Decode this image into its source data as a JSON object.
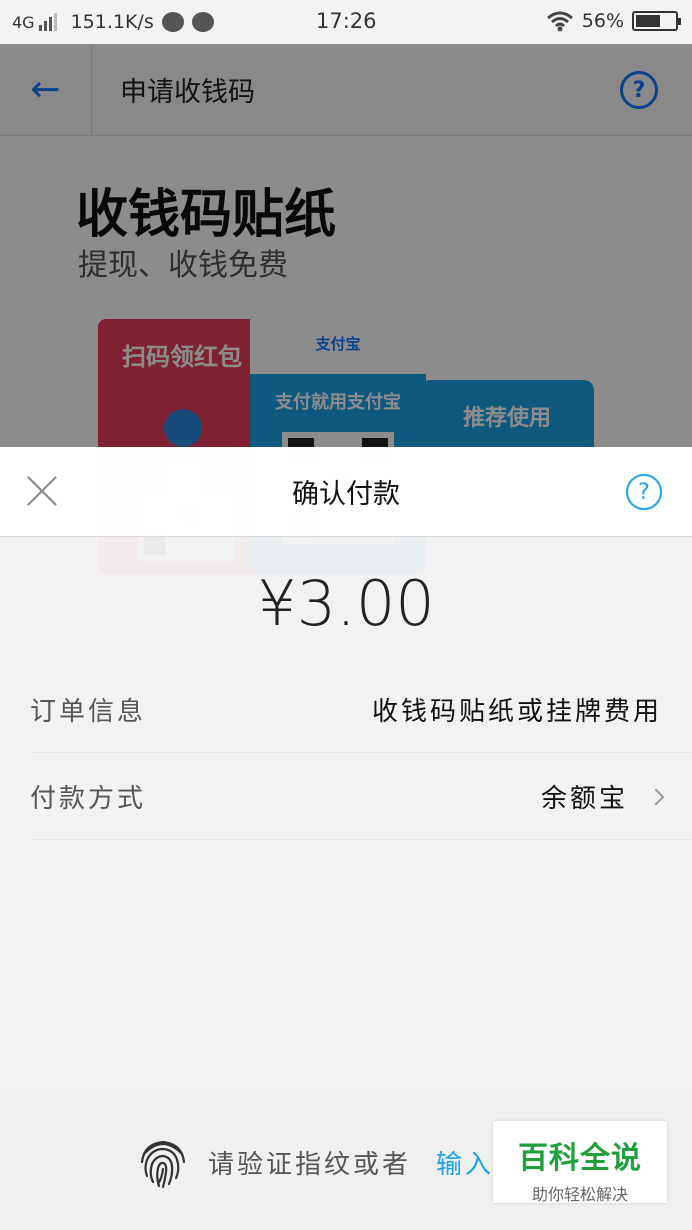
{
  "status_bar": {
    "network": "4G",
    "speed": "151.1K/s",
    "time": "17:26",
    "battery": "56%",
    "battery_level": 0.56
  },
  "background_page": {
    "title": "申请收钱码",
    "help_glyph": "?",
    "promo_title": "收钱码贴纸",
    "promo_subtitle": "提现、收钱免费",
    "sticker_red_text": "扫码领红包",
    "sticker_blue_logo": "支付宝",
    "sticker_blue_text": "支付就用支付宝",
    "recommend_label": "推荐使用"
  },
  "dialog": {
    "title": "确认付款",
    "help_glyph": "?",
    "amount": "¥3.00",
    "rows": [
      {
        "label": "订单信息",
        "value": "收钱码贴纸或挂牌费用"
      },
      {
        "label": "付款方式",
        "value": "余额宝"
      }
    ],
    "fingerprint_prompt": "请验证指纹或者",
    "input_link": "输入"
  },
  "watermark": {
    "main": "百科全说",
    "sub": "助你轻松解决"
  },
  "colors": {
    "accent": "#1da1e6",
    "alipay_blue": "#1677ff",
    "red_sticker": "#e83c5b",
    "watermark_green": "#1fa03a"
  }
}
